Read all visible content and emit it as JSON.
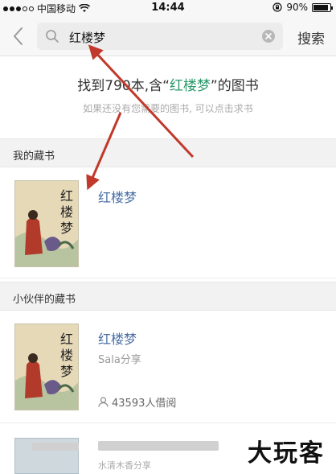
{
  "status_bar": {
    "carrier": "中国移动",
    "time": "14:44",
    "battery": "90%"
  },
  "search": {
    "query": "红楼梦",
    "button_label": "搜索"
  },
  "summary": {
    "prefix": "找到790本,含“",
    "keyword": "红楼梦",
    "suffix": "”的图书",
    "hint": "如果还没有您需要的图书, 可以点击求书"
  },
  "sections": {
    "mine": {
      "label": "我的藏书"
    },
    "friends": {
      "label": "小伙伴的藏书"
    }
  },
  "my_books": [
    {
      "title": "红楼梦",
      "cover_chars": "红楼梦"
    }
  ],
  "friend_books": [
    {
      "title": "红楼梦",
      "shared_by": "Sala分享",
      "borrow_count": "43593人借阅",
      "cover_chars": "红楼梦"
    }
  ],
  "partial_item": {
    "text": "水清木香分享"
  },
  "watermark": "大玩客",
  "colors": {
    "accent_green": "#2a9a6a",
    "link_blue": "#4a6fa5",
    "arrow_red": "#c0392b"
  },
  "icons": {
    "back": "chevron-left-icon",
    "search": "search-icon",
    "clear": "clear-icon",
    "user": "user-icon",
    "wifi": "wifi-icon",
    "lock": "rotation-lock-icon"
  }
}
